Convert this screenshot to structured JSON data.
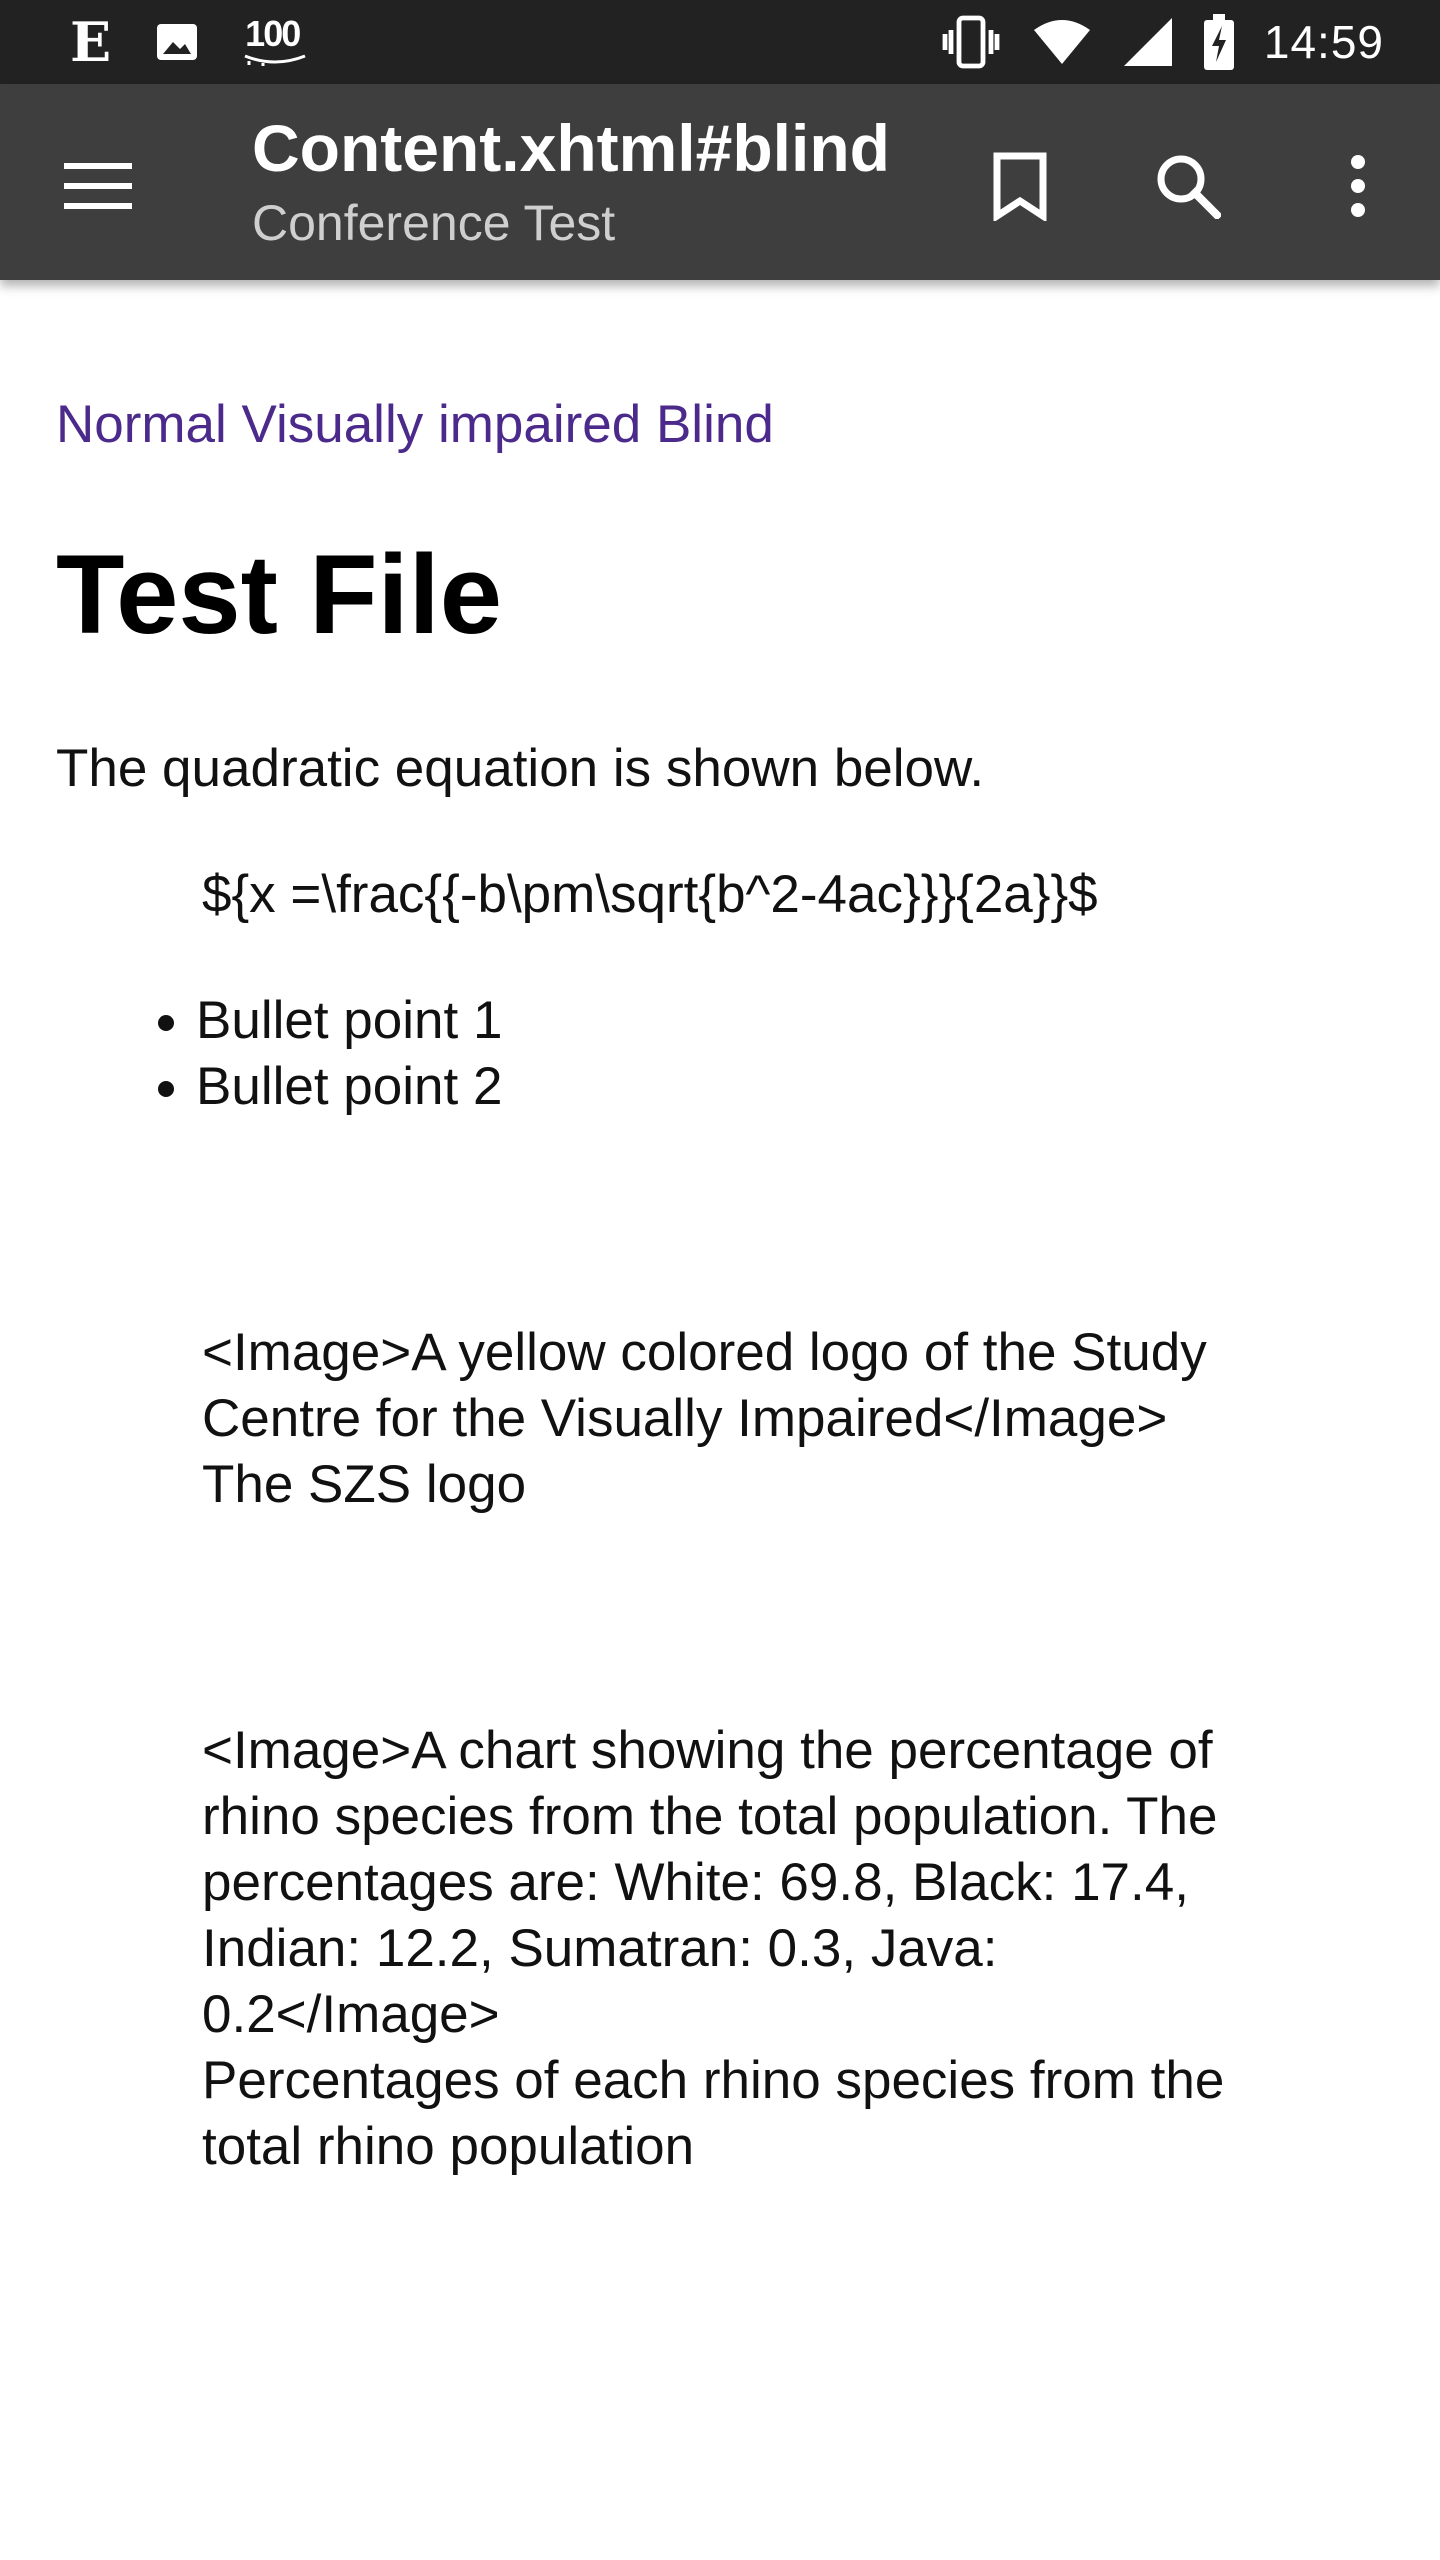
{
  "status_bar": {
    "battery_level": "100",
    "time": "14:59",
    "icons": [
      "e-app-icon",
      "image-icon",
      "battery-100-icon",
      "vibrate-icon",
      "wifi-icon",
      "signal-icon",
      "battery-charging-icon"
    ]
  },
  "app_bar": {
    "title": "Content.xhtml#blind",
    "subtitle": "Conference Test",
    "icons": [
      "menu-icon",
      "bookmark-icon",
      "search-icon",
      "more-vertical-icon"
    ]
  },
  "content": {
    "mode_links": [
      "Normal",
      "Visually impaired",
      "Blind"
    ],
    "title": "Test File",
    "intro": "The quadratic equation is shown below.",
    "equation": "${x =\\frac{{-b\\pm\\sqrt{b^2-4ac}}}{2a}}$",
    "bullets": [
      "Bullet point 1",
      "Bullet point 2"
    ],
    "figures": [
      {
        "alt": "<Image>A yellow colored logo of the Study Centre for the Visually Impaired</Image>",
        "caption": "The SZS logo"
      },
      {
        "alt": "<Image>A chart showing the percentage of rhino species from the total population. The percentages are: White: 69.8, Black: 17.4, Indian: 12.2, Sumatran: 0.3, Java: 0.2</Image>",
        "caption": "Percentages of each rhino species from the total rhino population"
      }
    ]
  },
  "colors": {
    "status_bar": "#222222",
    "app_bar": "#3e3e3e",
    "link": "#4b2a8c",
    "background": "#ffffff"
  }
}
